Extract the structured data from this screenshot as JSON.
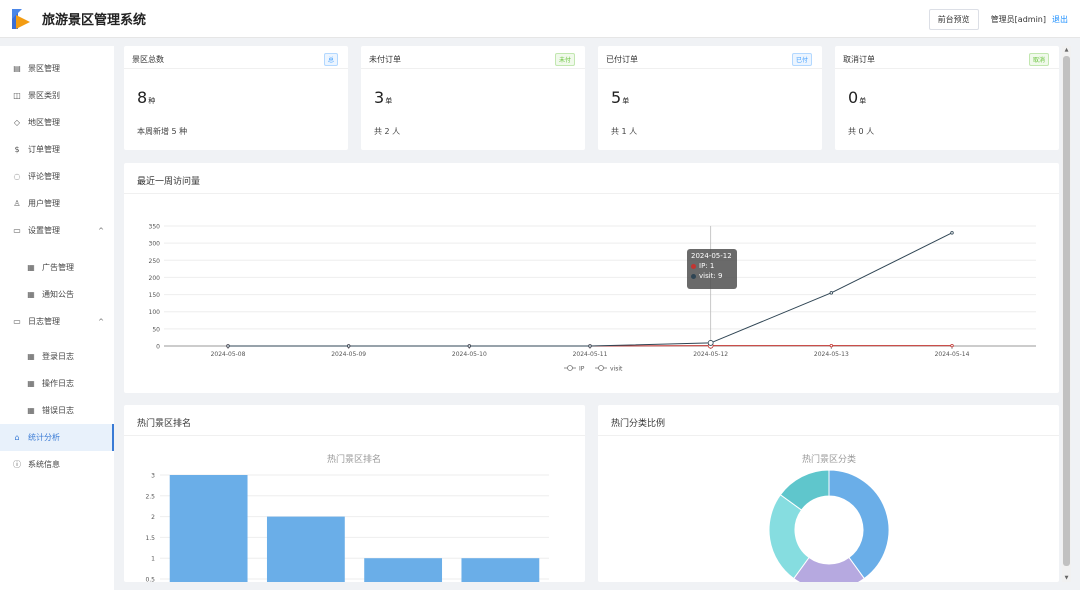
{
  "header": {
    "title": "旅游景区管理系统",
    "preview_button": "前台预览",
    "admin_label": "管理员[admin]",
    "logout": "退出"
  },
  "sidebar": {
    "items": [
      {
        "label": "景区管理"
      },
      {
        "label": "景区类别"
      },
      {
        "label": "地区管理"
      },
      {
        "label": "订单管理"
      },
      {
        "label": "评论管理"
      },
      {
        "label": "用户管理"
      },
      {
        "label": "设置管理"
      },
      {
        "label": "广告管理"
      },
      {
        "label": "通知公告"
      },
      {
        "label": "日志管理"
      },
      {
        "label": "登录日志"
      },
      {
        "label": "操作日志"
      },
      {
        "label": "错误日志"
      },
      {
        "label": "统计分析"
      },
      {
        "label": "系统信息"
      }
    ]
  },
  "stats": [
    {
      "title": "景区总数",
      "badge": "总",
      "value": "8",
      "unit": "种",
      "foot": "本周新增 5 种",
      "badge_color": "#409eff"
    },
    {
      "title": "未付订单",
      "badge": "未付",
      "value": "3",
      "unit": "单",
      "foot": "共 2 人",
      "badge_color": "#67c23a"
    },
    {
      "title": "已付订单",
      "badge": "已付",
      "value": "5",
      "unit": "单",
      "foot": "共 1 人",
      "badge_color": "#409eff"
    },
    {
      "title": "取消订单",
      "badge": "取消",
      "value": "0",
      "unit": "单",
      "foot": "共 0 人",
      "badge_color": "#67c23a"
    }
  ],
  "visit_panel": {
    "title": "最近一周访问量"
  },
  "ranking_panel": {
    "title": "热门景区排名"
  },
  "category_panel": {
    "title": "热门分类比例"
  },
  "tooltip": {
    "date": "2024-05-12",
    "ip_text": "IP: 1",
    "visit_text": "visit: 9"
  },
  "chart_data": [
    {
      "type": "line",
      "x": [
        "2024-05-08",
        "2024-05-09",
        "2024-05-10",
        "2024-05-11",
        "2024-05-12",
        "2024-05-13",
        "2024-05-14"
      ],
      "series": [
        {
          "name": "IP",
          "values": [
            0,
            0,
            0,
            0,
            1,
            1,
            1
          ],
          "color": "#c23531"
        },
        {
          "name": "visit",
          "values": [
            0,
            0,
            0,
            0,
            9,
            155,
            330
          ],
          "color": "#2f4554"
        }
      ],
      "ylim": [
        0,
        350
      ],
      "yticks": [
        0,
        50,
        100,
        150,
        200,
        250,
        300,
        350
      ],
      "grid": true,
      "legend": "bottom"
    },
    {
      "type": "bar",
      "title": "热门景区排名",
      "categories": [
        "",
        "",
        "",
        ""
      ],
      "values": [
        3,
        2,
        1,
        1
      ],
      "ylim": [
        0.5,
        3
      ],
      "yticks": [
        0.5,
        1,
        1.5,
        2,
        2.5,
        3
      ],
      "color": "#6aaee8"
    },
    {
      "type": "pie",
      "title": "热门景区分类",
      "values": [
        40,
        20,
        25,
        15
      ],
      "colors": [
        "#6aaee8",
        "#b6a9e0",
        "#86dde0",
        "#5fc6cc"
      ]
    }
  ]
}
